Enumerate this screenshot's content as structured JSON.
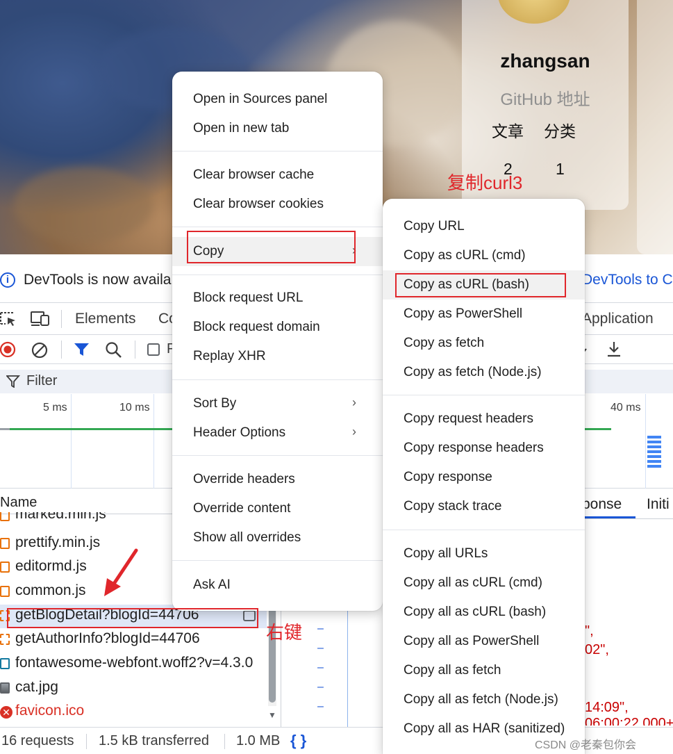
{
  "profile": {
    "name": "zhangsan",
    "github_link": "GitHub 地址",
    "stats": [
      {
        "label": "文章",
        "value": "2"
      },
      {
        "label": "分类",
        "value": "1"
      }
    ]
  },
  "annotations": {
    "copy_curl": "复制curl3",
    "right_click": "右键"
  },
  "colors": {
    "accent": "#1a56d6",
    "annotation_red": "#e0262b",
    "error": "#d93025"
  },
  "devtools": {
    "infobar": {
      "text": "DevTools is now availa",
      "link": "DevTools to Ch"
    },
    "tabs": [
      "Elements",
      "Co",
      "Application"
    ],
    "filter_label": "Filter",
    "ticks": [
      "5 ms",
      "10 ms",
      "40 ms"
    ],
    "name_header": "Name",
    "requests": [
      {
        "name": "marked.min.js",
        "icon": "script-icon"
      },
      {
        "name": "prettify.min.js",
        "icon": "script-icon"
      },
      {
        "name": "editormd.js",
        "icon": "script-icon"
      },
      {
        "name": "common.js",
        "icon": "script-icon"
      },
      {
        "name": "getBlogDetail?blogId=44706",
        "icon": "xhr-icon"
      },
      {
        "name": "getAuthorInfo?blogId=44706",
        "icon": "xhr-icon"
      },
      {
        "name": "fontawesome-webfont.woff2?v=4.3.0",
        "icon": "font-icon"
      },
      {
        "name": "cat.jpg",
        "icon": "image-icon"
      },
      {
        "name": "favicon.ico",
        "icon": "error-icon"
      }
    ],
    "detail_tabs": [
      "ponse",
      "Initi"
    ],
    "code_fragments": [
      "\",",
      "02\",",
      "14:09\",",
      "06:00:22.000+"
    ],
    "status": {
      "requests": "16 requests",
      "transferred": "1.5 kB transferred",
      "resources": "1.0 MB"
    },
    "checkbox_label": "P"
  },
  "menu_main": {
    "groups": [
      [
        "Open in Sources panel",
        "Open in new tab"
      ],
      [
        "Clear browser cache",
        "Clear browser cookies"
      ],
      [
        "Copy"
      ],
      [
        "Block request URL",
        "Block request domain",
        "Replay XHR"
      ],
      [
        "Sort By",
        "Header Options"
      ],
      [
        "Override headers",
        "Override content",
        "Show all overrides"
      ],
      [
        "Ask AI"
      ]
    ]
  },
  "menu_copy": {
    "groups": [
      [
        "Copy URL",
        "Copy as cURL (cmd)",
        "Copy as cURL (bash)",
        "Copy as PowerShell",
        "Copy as fetch",
        "Copy as fetch (Node.js)"
      ],
      [
        "Copy request headers",
        "Copy response headers",
        "Copy response",
        "Copy stack trace"
      ],
      [
        "Copy all URLs",
        "Copy all as cURL (cmd)",
        "Copy all as cURL (bash)",
        "Copy all as PowerShell",
        "Copy all as fetch",
        "Copy all as fetch (Node.js)",
        "Copy all as HAR (sanitized)"
      ]
    ]
  },
  "watermark": "CSDN @老秦包你会"
}
